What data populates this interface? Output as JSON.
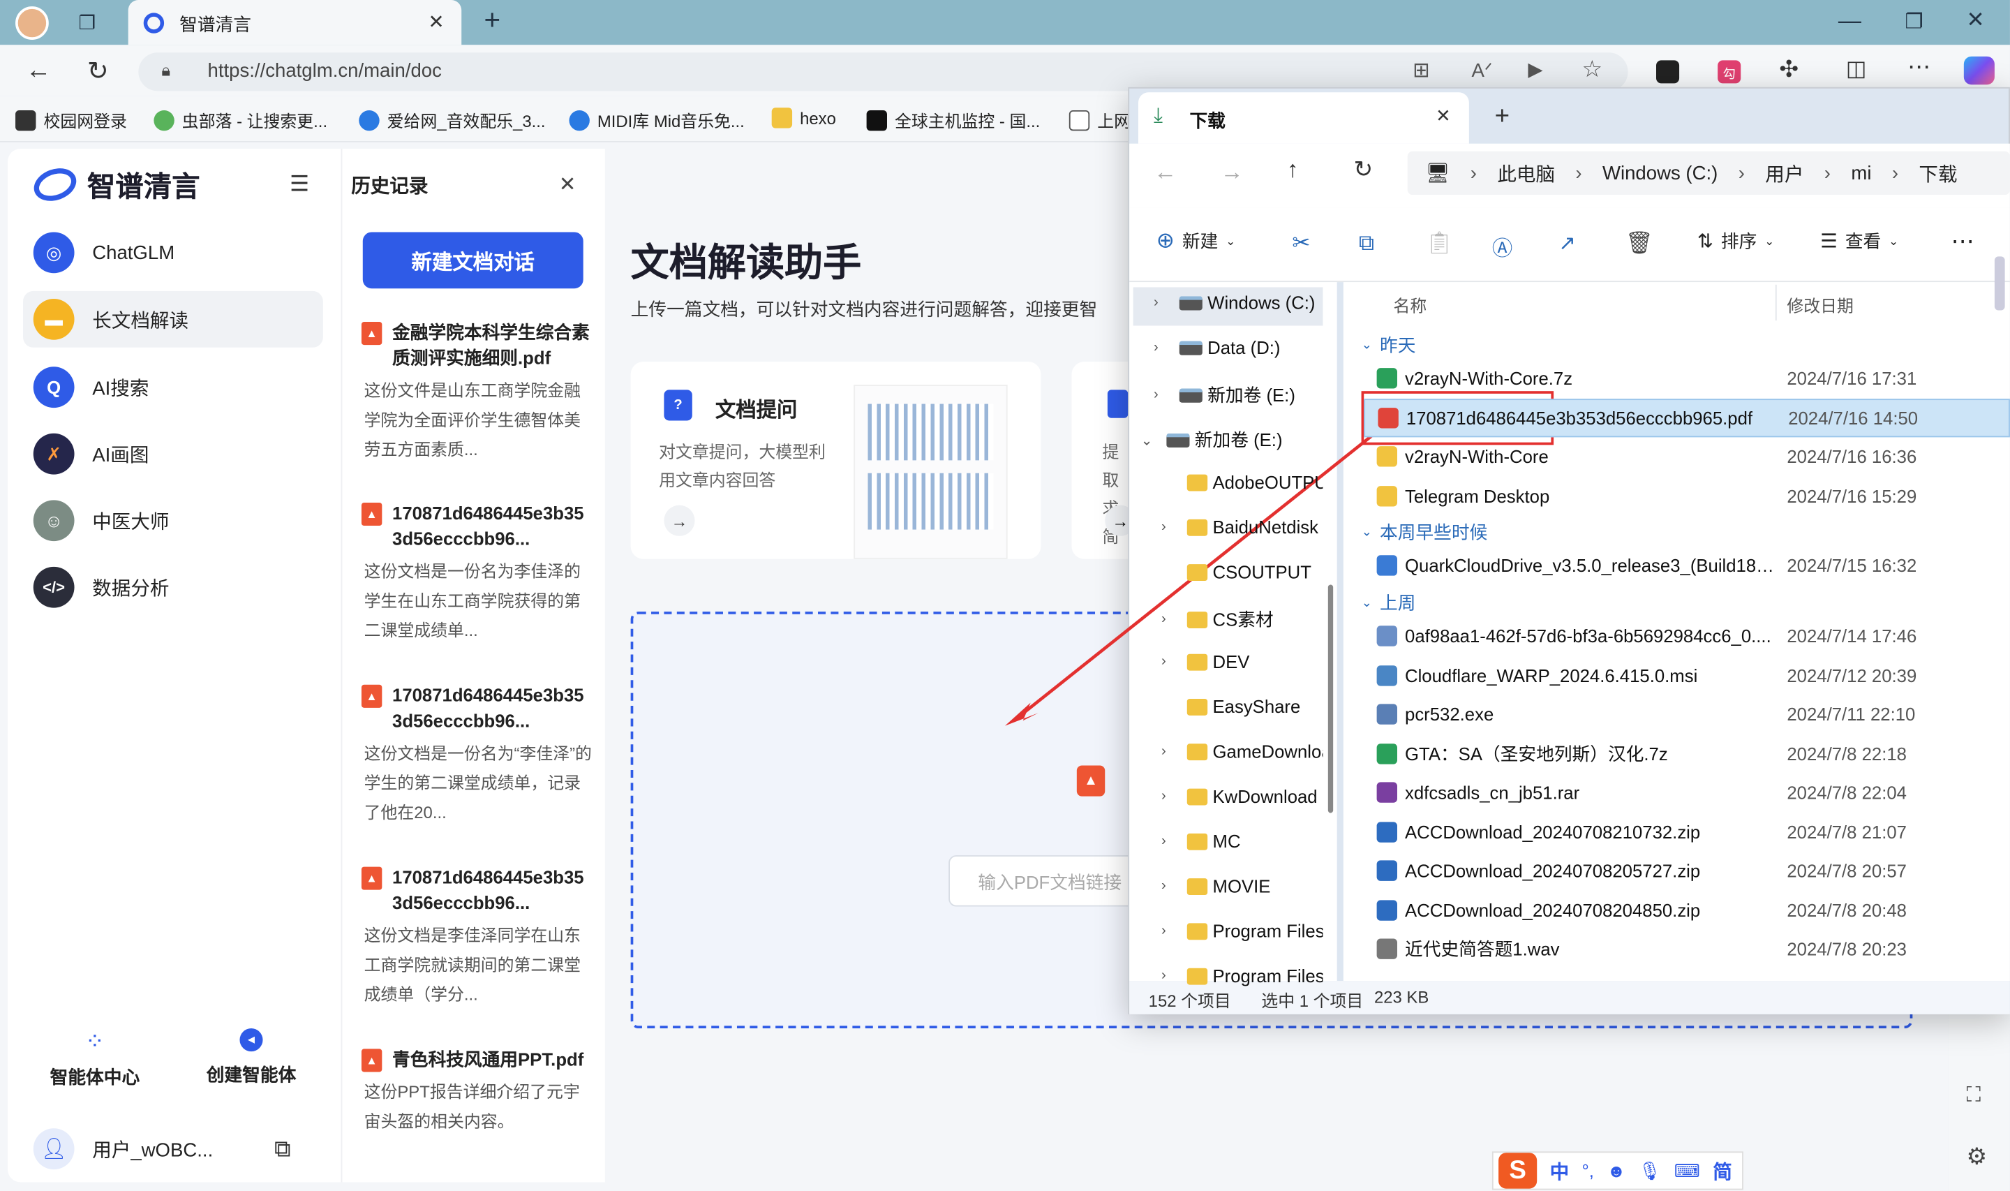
{
  "browser": {
    "tab_title": "智谱清言",
    "url": "https://chatglm.cn/main/doc",
    "bookmarks": [
      "校园网登录",
      "虫部落 - 让搜索更...",
      "爱给网_音效配乐_3...",
      "MIDI库 Mid音乐免...",
      "hexo",
      "全球主机监控 - 国...",
      "上网"
    ]
  },
  "app": {
    "logo": "智谱清言",
    "nav": [
      {
        "label": "ChatGLM",
        "icon": "chatglm-icon"
      },
      {
        "label": "长文档解读",
        "icon": "folder-icon"
      },
      {
        "label": "AI搜索",
        "icon": "search-icon"
      },
      {
        "label": "AI画图",
        "icon": "paint-icon"
      },
      {
        "label": "中医大师",
        "icon": "doctor-avatar"
      },
      {
        "label": "数据分析",
        "icon": "code-icon"
      }
    ],
    "agent_center": "智能体中心",
    "create_agent": "创建智能体",
    "user": "用户_wOBC..."
  },
  "history": {
    "title": "历史记录",
    "new_button": "新建文档对话",
    "items": [
      {
        "title": "金融学院本科学生综合素质测评实施细则.pdf",
        "desc": "这份文件是山东工商学院金融学院为全面评价学生德智体美劳五方面素质..."
      },
      {
        "title": "170871d6486445e3b353d56ecccbb96...",
        "desc": "这份文档是一份名为李佳泽的学生在山东工商学院获得的第二课堂成绩单..."
      },
      {
        "title": "170871d6486445e3b353d56ecccbb96...",
        "desc": "这份文档是一份名为“李佳泽”的学生的第二课堂成绩单，记录了他在20..."
      },
      {
        "title": "170871d6486445e3b353d56ecccbb96...",
        "desc": "这份文档是李佳泽同学在山东工商学院就读期间的第二课堂成绩单（学分..."
      },
      {
        "title": "青色科技风通用PPT.pdf",
        "desc": "这份PPT报告详细介绍了元宇宙头盔的相关内容。"
      }
    ]
  },
  "main": {
    "title": "文档解读助手",
    "subtitle": "上传一篇文档，可以针对文档内容进行问题解答，迎接更智",
    "card1_title": "文档提问",
    "card1_desc": "对文章提问，大模型利用文章内容回答",
    "card2_desc": "提取求简",
    "pdf_link_placeholder": "输入PDF文档链接"
  },
  "explorer": {
    "tab_title": "下载",
    "breadcrumb": [
      "此电脑",
      "Windows (C:)",
      "用户",
      "mi",
      "下载"
    ],
    "commands": {
      "new": "新建",
      "sort": "排序",
      "view": "查看"
    },
    "tree": [
      {
        "label": "Windows (C:)",
        "type": "drive",
        "chev": "›"
      },
      {
        "label": "Data (D:)",
        "type": "drive",
        "chev": "›"
      },
      {
        "label": "新加卷 (E:)",
        "type": "drive",
        "chev": "›"
      },
      {
        "label": "新加卷 (E:)",
        "type": "drive",
        "chev": "⌄"
      },
      {
        "label": "AdobeOUTPUT",
        "type": "folder",
        "chev": ""
      },
      {
        "label": "BaiduNetdisk",
        "type": "folder",
        "chev": "›"
      },
      {
        "label": "CSOUTPUT",
        "type": "folder",
        "chev": ""
      },
      {
        "label": "CS素材",
        "type": "folder",
        "chev": "›"
      },
      {
        "label": "DEV",
        "type": "folder",
        "chev": "›"
      },
      {
        "label": "EasyShare",
        "type": "folder",
        "chev": ""
      },
      {
        "label": "GameDownload",
        "type": "folder",
        "chev": "›"
      },
      {
        "label": "KwDownload",
        "type": "folder",
        "chev": "›"
      },
      {
        "label": "MC",
        "type": "folder",
        "chev": "›"
      },
      {
        "label": "MOVIE",
        "type": "folder",
        "chev": "›"
      },
      {
        "label": "Program Files",
        "type": "folder",
        "chev": "›"
      },
      {
        "label": "Program Files",
        "type": "folder",
        "chev": "›"
      }
    ],
    "columns": {
      "name": "名称",
      "date": "修改日期"
    },
    "groups": {
      "yesterday": "昨天",
      "earlier_week": "本周早些时候",
      "last_week": "上周"
    },
    "files_yesterday": [
      {
        "name": "v2rayN-With-Core.7z",
        "date": "2024/7/16 17:31",
        "color": "#2aa05a"
      },
      {
        "name": "170871d6486445e3b353d56ecccbb965.pdf",
        "date": "2024/7/16 14:50",
        "color": "#e0443a"
      },
      {
        "name": "v2rayN-With-Core",
        "date": "2024/7/16 16:36",
        "color": "#f1c33f"
      },
      {
        "name": "Telegram Desktop",
        "date": "2024/7/16 15:29",
        "color": "#f1c33f"
      }
    ],
    "files_earlier": [
      {
        "name": "QuarkCloudDrive_v3.5.0_release3_(Build184...",
        "date": "2024/7/15 16:32",
        "color": "#3a7bd5"
      }
    ],
    "files_lastweek": [
      {
        "name": "0af98aa1-462f-57d6-bf3a-6b5692984cc6_0....",
        "date": "2024/7/14 17:46",
        "color": "#6b8fc7"
      },
      {
        "name": "Cloudflare_WARP_2024.6.415.0.msi",
        "date": "2024/7/12 20:39",
        "color": "#4a86c5"
      },
      {
        "name": "pcr532.exe",
        "date": "2024/7/11 22:10",
        "color": "#5a7fb5"
      },
      {
        "name": "GTA：SA（圣安地列斯）汉化.7z",
        "date": "2024/7/8 22:18",
        "color": "#2aa05a"
      },
      {
        "name": "xdfcsadls_cn_jb51.rar",
        "date": "2024/7/8 22:04",
        "color": "#7a3fa0"
      },
      {
        "name": "ACCDownload_20240708210732.zip",
        "date": "2024/7/8 21:07",
        "color": "#2d6cc0"
      },
      {
        "name": "ACCDownload_20240708205727.zip",
        "date": "2024/7/8 20:57",
        "color": "#2d6cc0"
      },
      {
        "name": "ACCDownload_20240708204850.zip",
        "date": "2024/7/8 20:48",
        "color": "#2d6cc0"
      },
      {
        "name": "近代史简答题1.wav",
        "date": "2024/7/8 20:23",
        "color": "#777777"
      }
    ],
    "status_items": "152 个项目",
    "status_selected": "选中 1 个项目",
    "status_size": "223 KB"
  },
  "ime": {
    "lang": "中",
    "mode": "简"
  }
}
